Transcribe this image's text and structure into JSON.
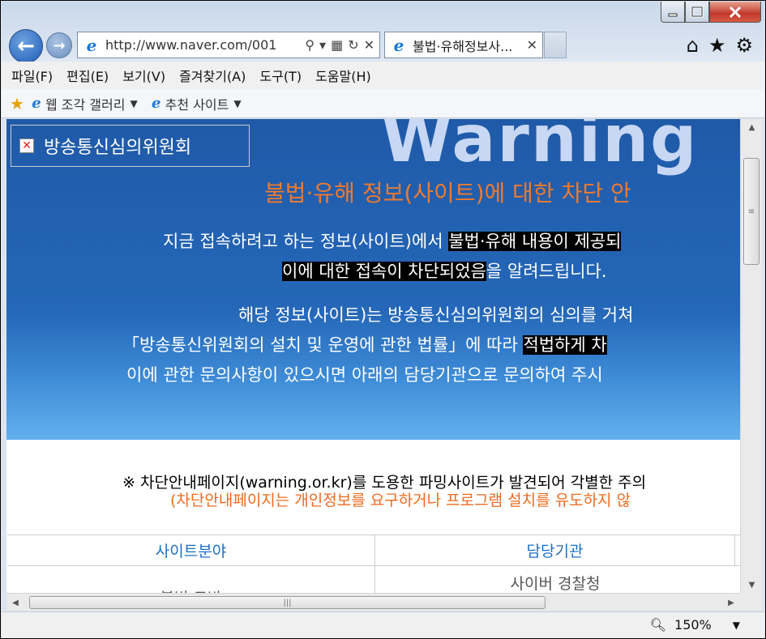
{
  "browser": {
    "address_url": "http://www.naver.com/001",
    "tab_title": "불법·유해정보사...",
    "menu": [
      "파일(F)",
      "편집(E)",
      "보기(V)",
      "즐겨찾기(A)",
      "도구(T)",
      "도움말(H)"
    ],
    "favorites": [
      "웹 조각 갤러리",
      "추천 사이트"
    ],
    "zoom": "150%"
  },
  "page": {
    "big_word": "Warning",
    "logo_alt": "방송통신심의위원회",
    "subtitle": "불법·유해 정보(사이트)에 대한 차단 안",
    "p1a_pre": "지금 접속하려고 하는 정보(사이트)에서 ",
    "p1a_hl": "불법·유해 내용이 제공되",
    "p1b_hl": "이에 대한 접속이 차단되었음",
    "p1b_post": "을 알려드립니다.",
    "p2a": "해당 정보(사이트)는 방송통신심의위원회의 심의를 거쳐",
    "p2b_pre": "「방송통신위원회의 설치 및 운영에 관한 법률」에 따라 ",
    "p2b_hl": "적법하게 차",
    "p2c": "이에 관한 문의사항이 있으시면 아래의 담당기관으로 문의하여 주시",
    "notice1": "※ 차단안내페이지(warning.or.kr)를 도용한 파밍사이트가 발견되어 각별한 주의",
    "notice2": "(차단안내페이지는 개인정보를 요구하거나 프로그램 설치를 유도하지 않",
    "table_headers": [
      "사이트분야",
      "담당기관"
    ],
    "table_row1": [
      "불법 도박",
      "사이버 경찰청"
    ]
  }
}
